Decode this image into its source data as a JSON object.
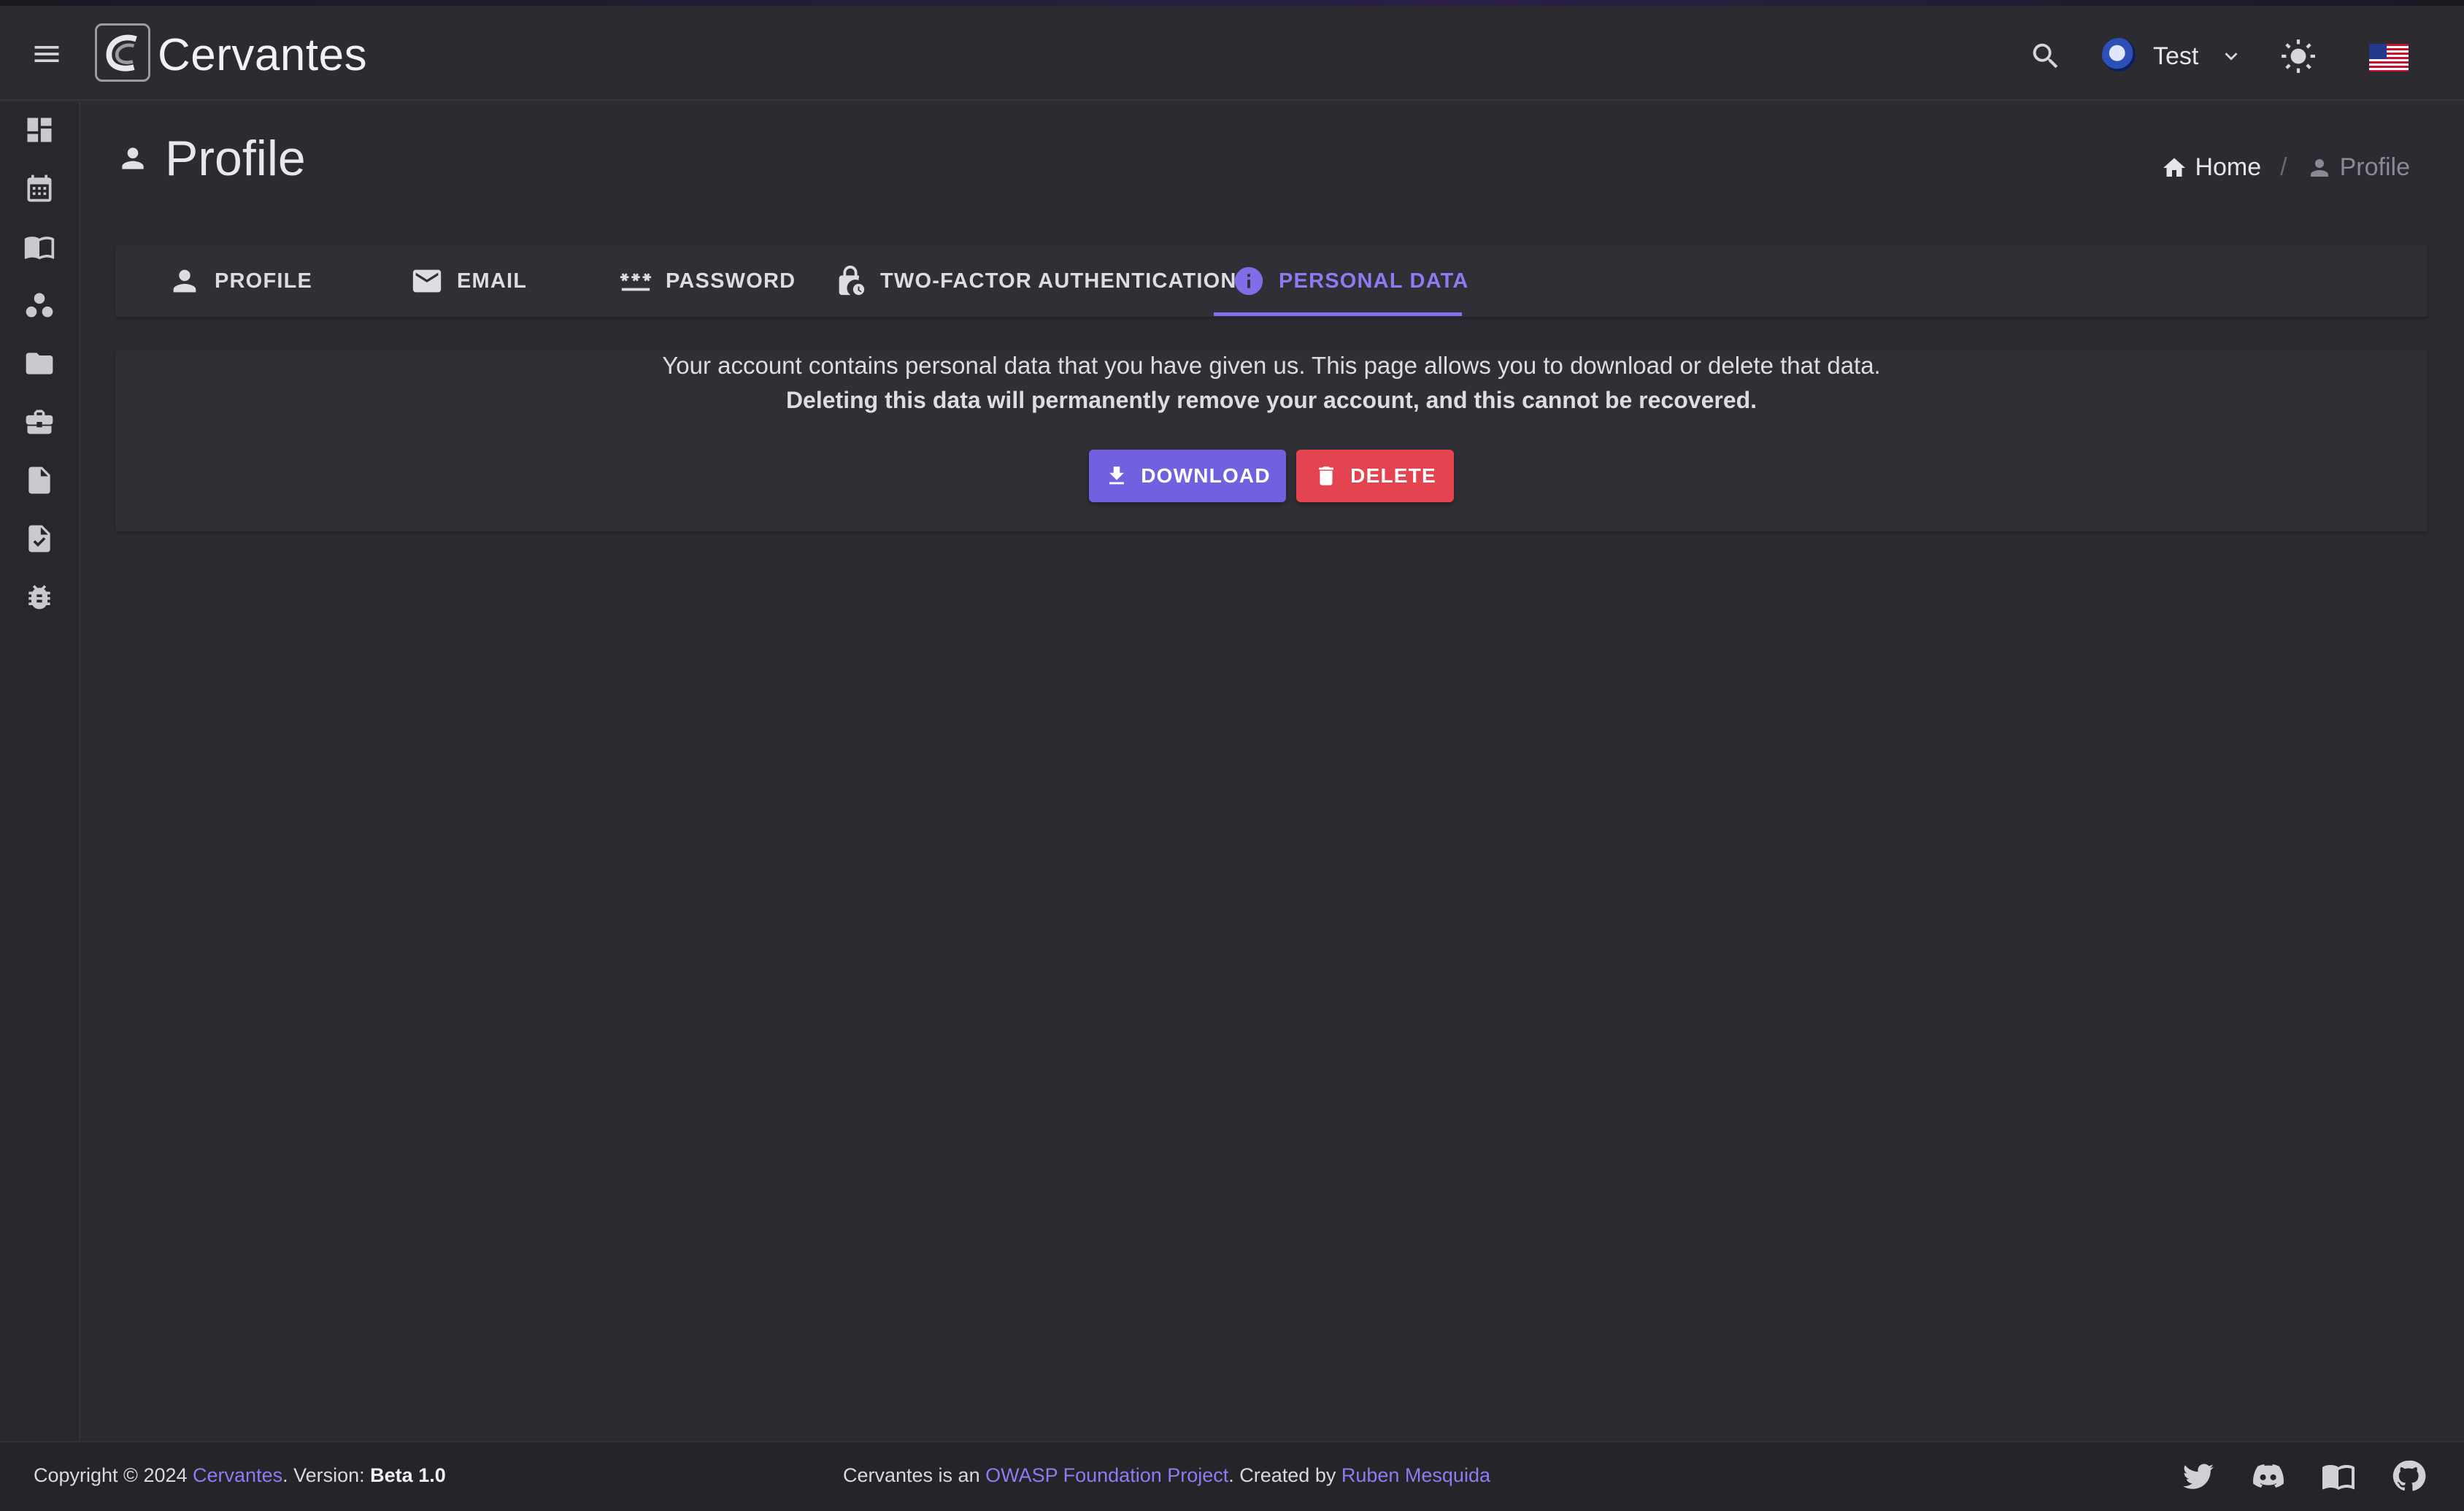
{
  "header": {
    "brand": "Cervantes",
    "user_name": "Test"
  },
  "page": {
    "title": "Profile"
  },
  "breadcrumb": {
    "home": "Home",
    "current": "Profile"
  },
  "tabs": [
    {
      "label": "PROFILE",
      "icon": "person-icon"
    },
    {
      "label": "EMAIL",
      "icon": "mail-icon"
    },
    {
      "label": "PASSWORD",
      "icon": "password-icon"
    },
    {
      "label": "TWO-FACTOR AUTHENTICATION",
      "icon": "lock-icon"
    },
    {
      "label": "PERSONAL DATA",
      "icon": "info-icon",
      "active": true
    }
  ],
  "personal_data": {
    "description": "Your account contains personal data that you have given us. This page allows you to download or delete that data.",
    "warning": "Deleting this data will permanently remove your account, and this cannot be recovered.",
    "download_label": "DOWNLOAD",
    "delete_label": "DELETE"
  },
  "footer": {
    "copyright_prefix": "Copyright © 2024 ",
    "copyright_link": "Cervantes",
    "version_prefix": ". Version: ",
    "version": "Beta 1.0",
    "center_prefix": "Cervantes is an ",
    "owasp_link": "OWASP Foundation Project",
    "created_by": ". Created by ",
    "author_link": "Ruben Mesquida"
  },
  "colors": {
    "accent": "#7161e0",
    "danger": "#e3444f",
    "background": "#2b2b31"
  }
}
